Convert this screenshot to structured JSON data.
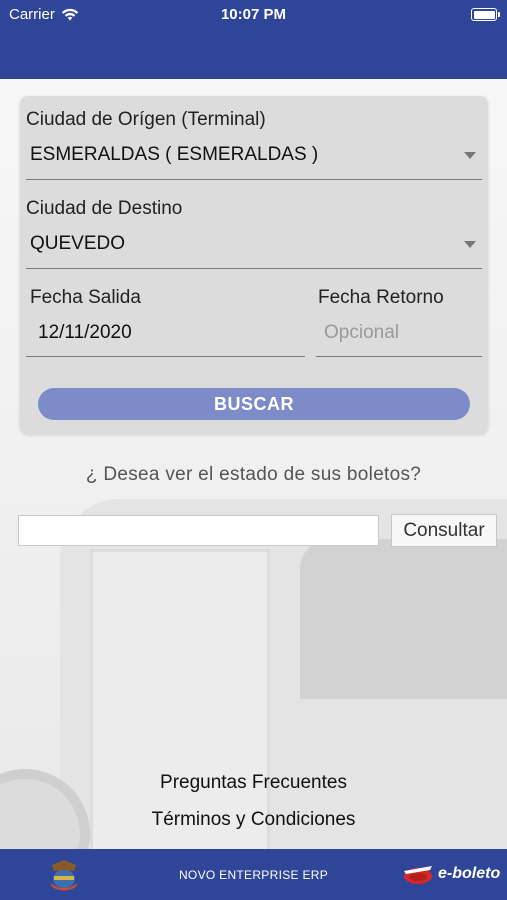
{
  "status_bar": {
    "carrier": "Carrier",
    "time": "10:07 PM"
  },
  "form": {
    "origin_label": "Ciudad de Orígen (Terminal)",
    "origin_value": "ESMERALDAS ( ESMERALDAS )",
    "destination_label": "Ciudad de Destino",
    "destination_value": "QUEVEDO",
    "departure_label": "Fecha Salida",
    "departure_value": "12/11/2020",
    "return_label": "Fecha Retorno",
    "return_placeholder": "Opcional",
    "search_button": "BUSCAR"
  },
  "tickets": {
    "question": "¿ Desea ver el estado de sus boletos?",
    "input_value": "",
    "consult_button": "Consultar"
  },
  "links": {
    "faq": "Preguntas Frecuentes",
    "terms": "Términos y Condiciones"
  },
  "footer": {
    "center_text": "NOVO ENTERPRISE ERP",
    "brand_logo_text": "e-boleto"
  },
  "colors": {
    "header_bg": "#2f4597",
    "button_bg": "#7d8cc9",
    "card_bg": "#dcdcdc"
  },
  "icons": [
    "wifi-icon",
    "battery-icon",
    "dropdown-arrow-icon",
    "coat-of-arms-icon",
    "e-boleto-logo"
  ]
}
